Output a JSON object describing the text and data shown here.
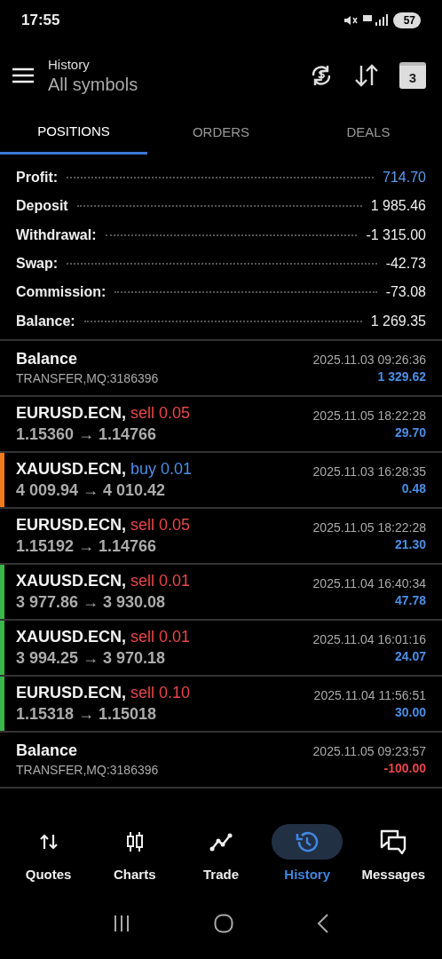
{
  "status_bar": {
    "time": "17:55",
    "battery": "57"
  },
  "header": {
    "title": "History",
    "subtitle": "All symbols",
    "calendar_day": "3"
  },
  "tabs": [
    {
      "label": "POSITIONS",
      "selected": true
    },
    {
      "label": "ORDERS",
      "selected": false
    },
    {
      "label": "DEALS",
      "selected": false
    }
  ],
  "summary": [
    {
      "label": "Profit:",
      "value": "714.70",
      "highlighted": true
    },
    {
      "label": "Deposit",
      "value": "1 985.46",
      "highlighted": false
    },
    {
      "label": "Withdrawal:",
      "value": "-1 315.00",
      "highlighted": false
    },
    {
      "label": "Swap:",
      "value": "-42.73",
      "highlighted": false
    },
    {
      "label": "Commission:",
      "value": "-73.08",
      "highlighted": false
    },
    {
      "label": "Balance:",
      "value": "1 269.35",
      "highlighted": false
    }
  ],
  "records": [
    {
      "kind": "balance",
      "title": "Balance",
      "detail": "TRANSFER,MQ:3186396",
      "time": "2025.11.03 09:26:36",
      "amount": "1 329.62",
      "loss": false
    },
    {
      "kind": "trade",
      "symbol": "EURUSD.ECN,",
      "buy": false,
      "side": "sell",
      "volume": "0.05",
      "prices": "1.15360 → 1.14766",
      "time": "2025.11.05 18:22:28",
      "amount": "29.70",
      "loss": false
    },
    {
      "kind": "trade",
      "symbol": "XAUUSD.ECN,",
      "buy": true,
      "side": "buy",
      "volume": "0.01",
      "prices": "4 009.94 → 4 010.42",
      "time": "2025.11.03 16:28:35",
      "amount": "0.48",
      "loss": false,
      "color": "#f07b1d"
    },
    {
      "kind": "trade",
      "symbol": "EURUSD.ECN,",
      "buy": false,
      "side": "sell",
      "volume": "0.05",
      "prices": "1.15192 → 1.14766",
      "time": "2025.11.05 18:22:28",
      "amount": "21.30",
      "loss": false
    },
    {
      "kind": "trade",
      "symbol": "XAUUSD.ECN,",
      "buy": false,
      "side": "sell",
      "volume": "0.01",
      "prices": "3 977.86 → 3 930.08",
      "time": "2025.11.04 16:40:34",
      "amount": "47.78",
      "loss": false,
      "color": "#3db54a"
    },
    {
      "kind": "trade",
      "symbol": "XAUUSD.ECN,",
      "buy": false,
      "side": "sell",
      "volume": "0.01",
      "prices": "3 994.25 → 3 970.18",
      "time": "2025.11.04 16:01:16",
      "amount": "24.07",
      "loss": false,
      "color": "#3db54a"
    },
    {
      "kind": "trade",
      "symbol": "EURUSD.ECN,",
      "buy": false,
      "side": "sell",
      "volume": "0.10",
      "prices": "1.15318 → 1.15018",
      "time": "2025.11.04 11:56:51",
      "amount": "30.00",
      "loss": false,
      "color": "#3db54a"
    },
    {
      "kind": "balance",
      "title": "Balance",
      "detail": "TRANSFER,MQ:3186396",
      "time": "2025.11.05 09:23:57",
      "amount": "-100.00",
      "loss": true
    }
  ],
  "bottom_nav": [
    {
      "label": "Quotes",
      "selected": false
    },
    {
      "label": "Charts",
      "selected": false
    },
    {
      "label": "Trade",
      "selected": false
    },
    {
      "label": "History",
      "selected": true
    },
    {
      "label": "Messages",
      "selected": false
    }
  ]
}
